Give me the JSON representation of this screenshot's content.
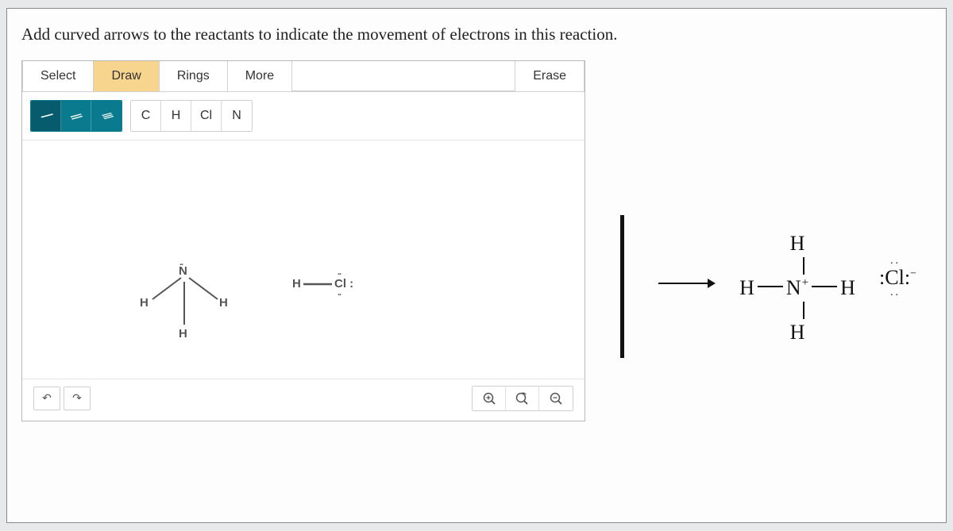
{
  "question": "Add curved arrows to the reactants to indicate the movement of electrons in this reaction.",
  "modes": {
    "select": "Select",
    "draw": "Draw",
    "rings": "Rings",
    "more": "More",
    "erase": "Erase"
  },
  "bonds": {
    "single": "/",
    "double": "//",
    "triple": "///"
  },
  "atoms": {
    "c": "C",
    "h": "H",
    "cl": "Cl",
    "n": "N"
  },
  "canvas_molecules": {
    "nh3_n_lonepair": "..",
    "nh3_n": "N",
    "nh3_h_left": "H",
    "nh3_h_right": "H",
    "nh3_h_bottom": "H",
    "hcl_h": "H",
    "hcl_cl_top": "..",
    "hcl_cl": "Cl :",
    "hcl_cl_bot": ".."
  },
  "icons": {
    "undo": "↶",
    "redo": "↷",
    "zoom_in": "⊕",
    "zoom_reset": "⤺",
    "zoom_out": "⊖",
    "zoom_reset_glyph": "🔍"
  },
  "products": {
    "ammonium_h": "H",
    "ammonium_n": "N",
    "ammonium_plus": "+",
    "chloride_label": "Cl",
    "chloride_dots": ":",
    "chloride_top_dots": "..",
    "chloride_neg": "−"
  }
}
